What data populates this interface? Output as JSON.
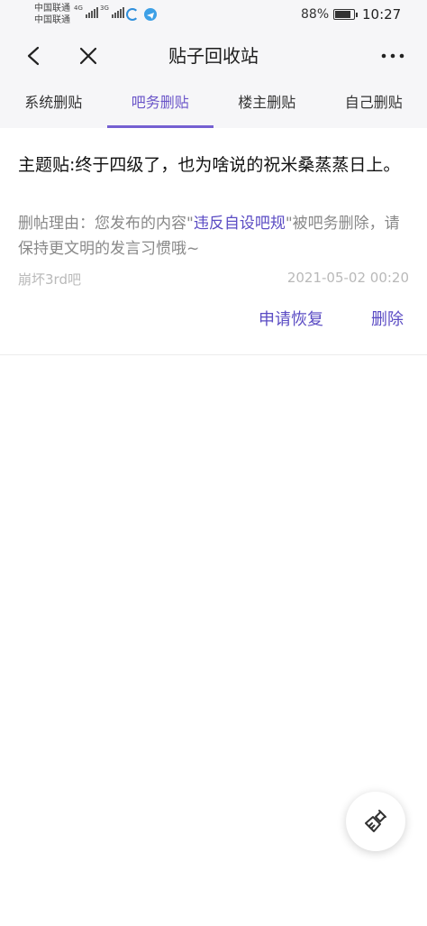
{
  "status_bar": {
    "carrier_1": "中国联通",
    "carrier_2": "中国联通",
    "network_1": "4G",
    "network_2": "3G",
    "battery_percent": "88%",
    "battery_level": 0.88,
    "time": "10:27"
  },
  "header": {
    "title": "贴子回收站",
    "back_icon": "chevron-left-icon",
    "close_icon": "close-icon",
    "more_icon": "more-horizontal-icon"
  },
  "tabs": [
    {
      "label": "系统删贴",
      "active": false
    },
    {
      "label": "吧务删贴",
      "active": true
    },
    {
      "label": "楼主删贴",
      "active": false
    },
    {
      "label": "自己删贴",
      "active": false
    }
  ],
  "post": {
    "title": "主题贴:终于四级了，也为啥说的祝米桑蒸蒸日上。",
    "reason_prefix": "删帖理由：您发布的内容\"",
    "reason_link": "违反自设吧规",
    "reason_suffix": "\"被吧务删除，请保持更文明的发言习惯哦~",
    "forum": "崩坏3rd吧",
    "time": "2021-05-02 00:20",
    "appeal_label": "申请恢复",
    "delete_label": "删除"
  },
  "fab": {
    "icon": "broom-icon"
  },
  "colors": {
    "accent": "#6b56c9",
    "link": "#5b4cc4",
    "header_bg": "#f6f6f8",
    "muted_text": "#888888"
  }
}
